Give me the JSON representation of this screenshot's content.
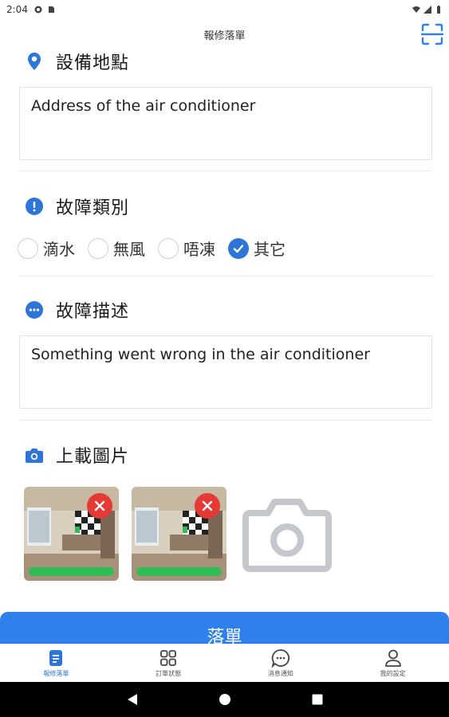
{
  "status_bar": {
    "time": "2:04"
  },
  "app_bar": {
    "title": "報修落單"
  },
  "location": {
    "label": "設備地點",
    "value": "Address of the air conditioner"
  },
  "fault_type": {
    "label": "故障類別",
    "options": [
      {
        "label": "滴水",
        "checked": false
      },
      {
        "label": "無風",
        "checked": false
      },
      {
        "label": "唔凍",
        "checked": false
      },
      {
        "label": "其它",
        "checked": true
      }
    ]
  },
  "description": {
    "label": "故障描述",
    "value": "Something went wrong  in the air conditioner"
  },
  "upload": {
    "label": "上載圖片",
    "images": [
      {
        "name": "room photo 1",
        "progress": 1.0
      },
      {
        "name": "room photo 2",
        "progress": 1.0
      }
    ]
  },
  "submit": {
    "label": "落單"
  },
  "tabs": [
    {
      "label": "報修落單",
      "icon": "document-icon",
      "active": true
    },
    {
      "label": "訂單狀態",
      "icon": "grid-icon",
      "active": false
    },
    {
      "label": "消息通知",
      "icon": "chat-icon",
      "active": false
    },
    {
      "label": "我的設定",
      "icon": "user-icon",
      "active": false
    }
  ],
  "colors": {
    "accent": "#2f75d8",
    "submit": "#2f80ed",
    "progress": "#2ebd55",
    "remove": "#e53935"
  }
}
